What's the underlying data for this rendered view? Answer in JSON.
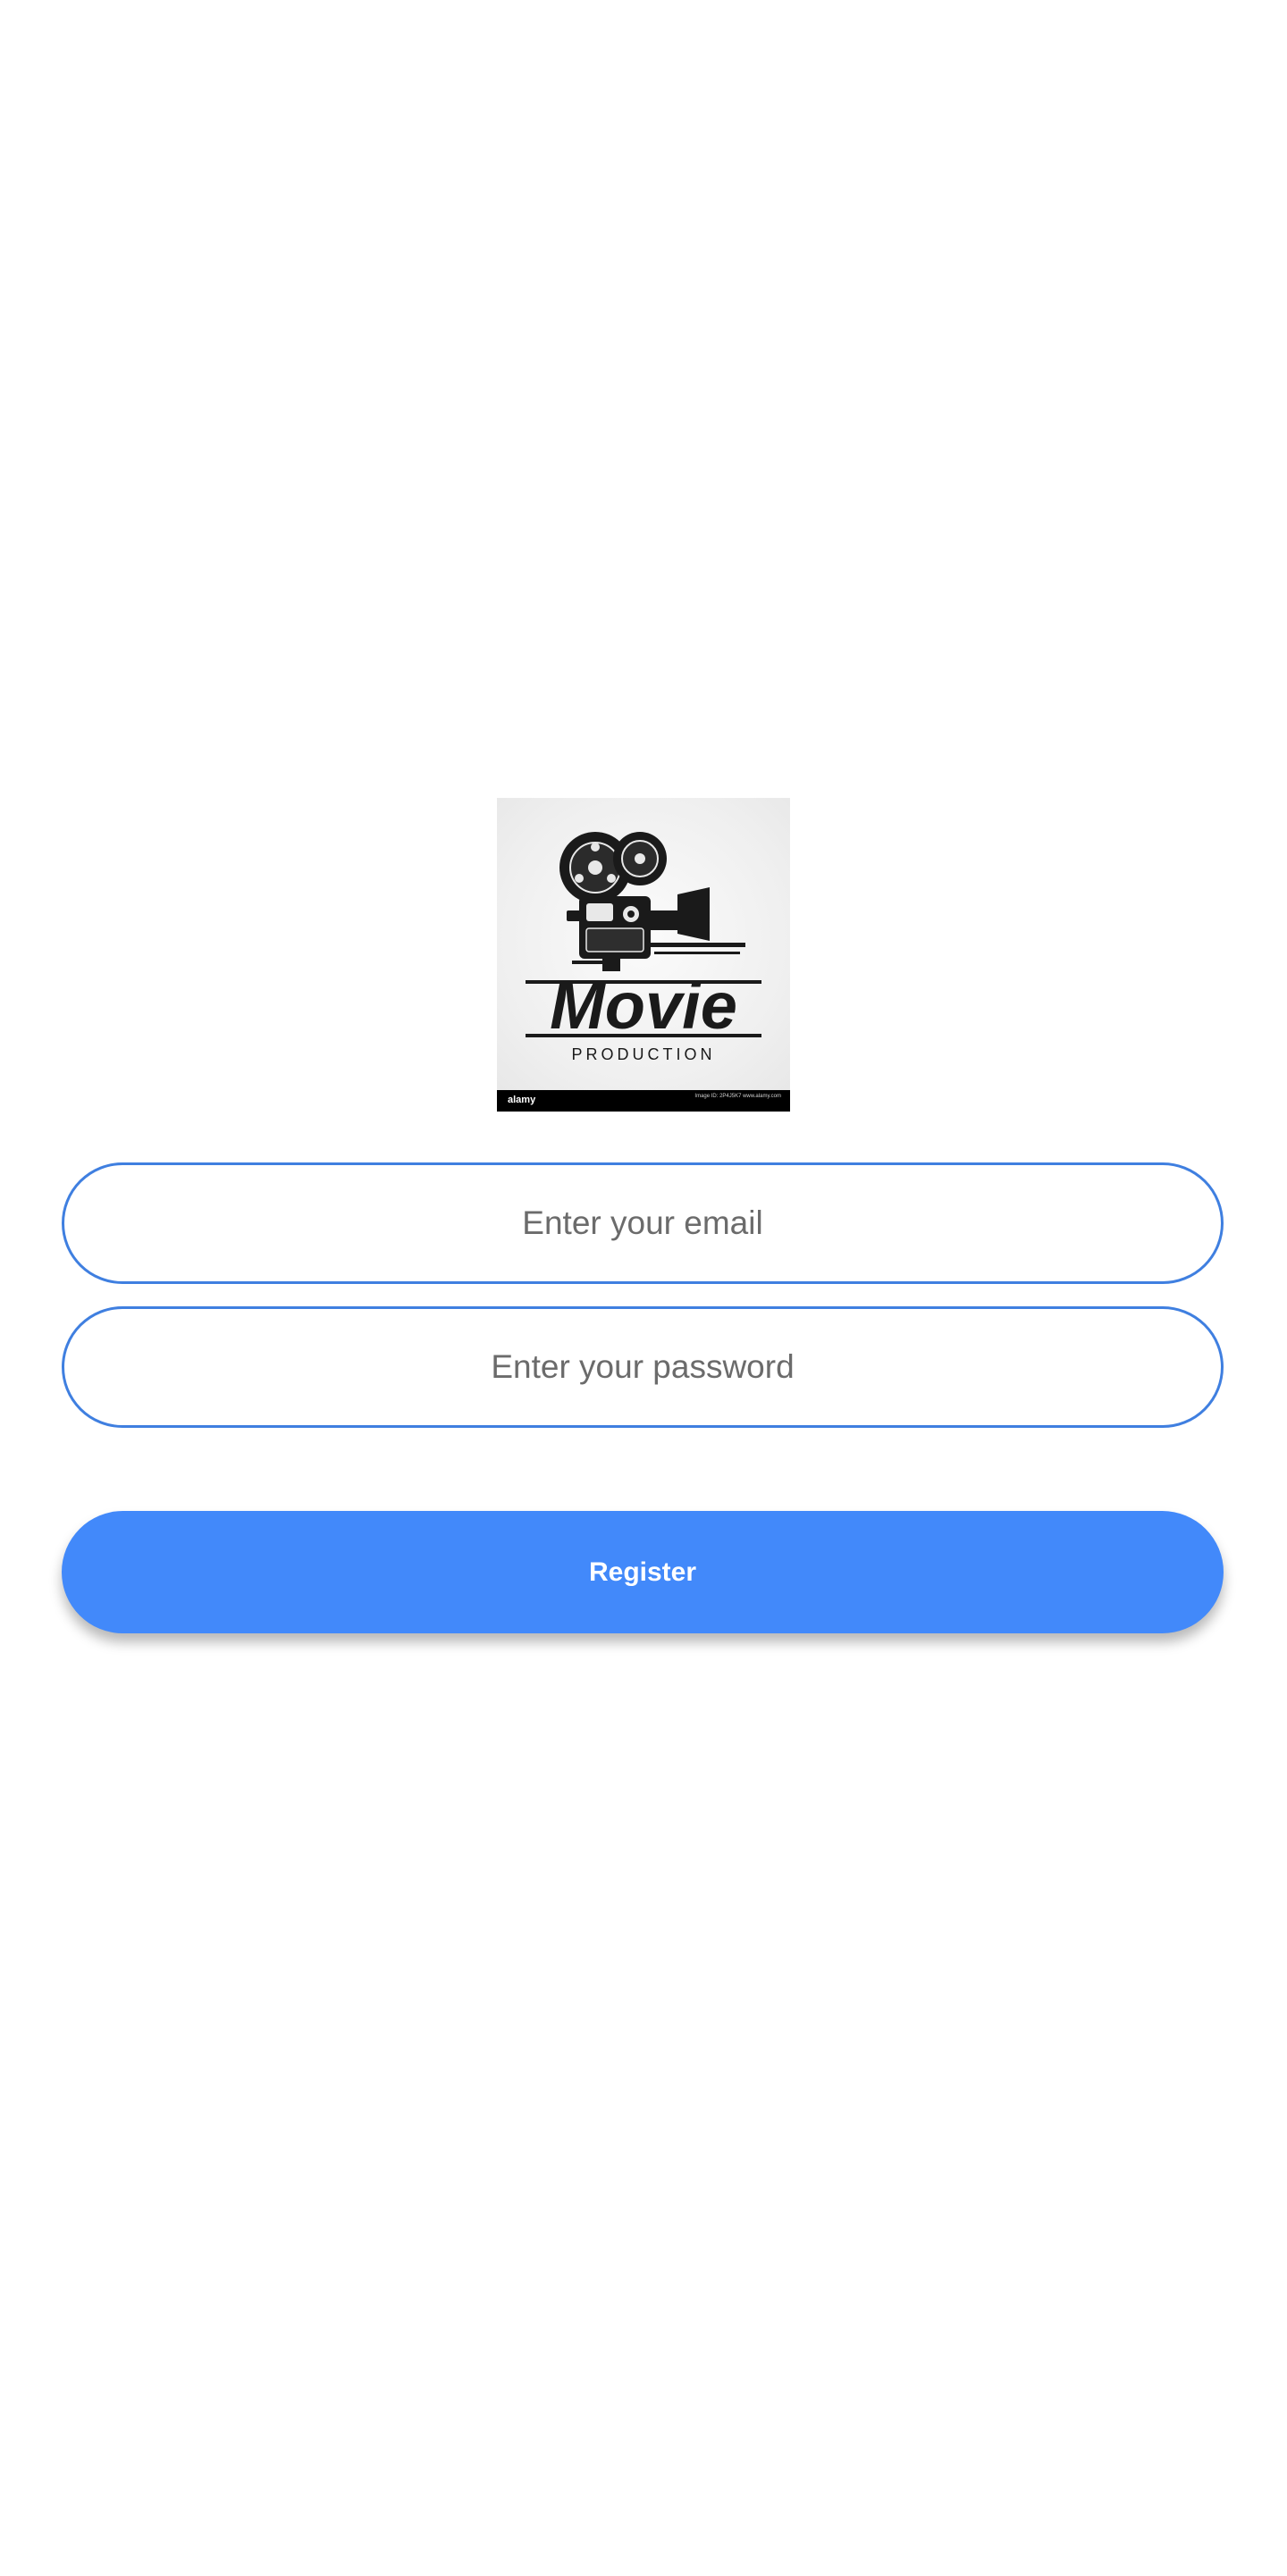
{
  "logo": {
    "title": "Movie",
    "subtitle": "PRODUCTION",
    "watermark_brand": "alamy",
    "watermark_id": "Image ID: 2P4J5K7\nwww.alamy.com",
    "icon": "vintage-film-camera-icon"
  },
  "form": {
    "email_placeholder": "Enter your email",
    "password_placeholder": "Enter your password",
    "register_label": "Register"
  },
  "colors": {
    "accent": "#4289fa",
    "field_border": "#3f7fe0",
    "placeholder": "#6b6b6b",
    "background": "#ffffff"
  }
}
